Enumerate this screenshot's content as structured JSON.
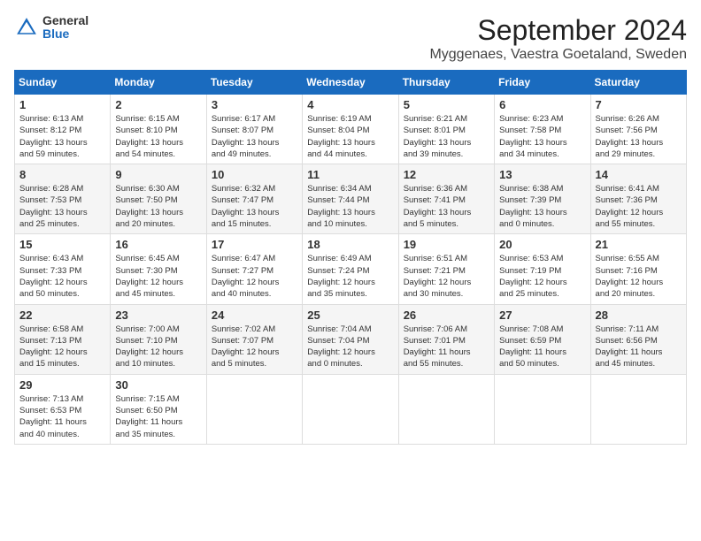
{
  "header": {
    "logo_general": "General",
    "logo_blue": "Blue",
    "month_title": "September 2024",
    "location": "Myggenaes, Vaestra Goetaland, Sweden"
  },
  "days_of_week": [
    "Sunday",
    "Monday",
    "Tuesday",
    "Wednesday",
    "Thursday",
    "Friday",
    "Saturday"
  ],
  "weeks": [
    [
      {
        "day": "1",
        "sunrise": "6:13 AM",
        "sunset": "8:12 PM",
        "daylight": "13 hours and 59 minutes"
      },
      {
        "day": "2",
        "sunrise": "6:15 AM",
        "sunset": "8:10 PM",
        "daylight": "13 hours and 54 minutes"
      },
      {
        "day": "3",
        "sunrise": "6:17 AM",
        "sunset": "8:07 PM",
        "daylight": "13 hours and 49 minutes"
      },
      {
        "day": "4",
        "sunrise": "6:19 AM",
        "sunset": "8:04 PM",
        "daylight": "13 hours and 44 minutes"
      },
      {
        "day": "5",
        "sunrise": "6:21 AM",
        "sunset": "8:01 PM",
        "daylight": "13 hours and 39 minutes"
      },
      {
        "day": "6",
        "sunrise": "6:23 AM",
        "sunset": "7:58 PM",
        "daylight": "13 hours and 34 minutes"
      },
      {
        "day": "7",
        "sunrise": "6:26 AM",
        "sunset": "7:56 PM",
        "daylight": "13 hours and 29 minutes"
      }
    ],
    [
      {
        "day": "8",
        "sunrise": "6:28 AM",
        "sunset": "7:53 PM",
        "daylight": "13 hours and 25 minutes"
      },
      {
        "day": "9",
        "sunrise": "6:30 AM",
        "sunset": "7:50 PM",
        "daylight": "13 hours and 20 minutes"
      },
      {
        "day": "10",
        "sunrise": "6:32 AM",
        "sunset": "7:47 PM",
        "daylight": "13 hours and 15 minutes"
      },
      {
        "day": "11",
        "sunrise": "6:34 AM",
        "sunset": "7:44 PM",
        "daylight": "13 hours and 10 minutes"
      },
      {
        "day": "12",
        "sunrise": "6:36 AM",
        "sunset": "7:41 PM",
        "daylight": "13 hours and 5 minutes"
      },
      {
        "day": "13",
        "sunrise": "6:38 AM",
        "sunset": "7:39 PM",
        "daylight": "13 hours and 0 minutes"
      },
      {
        "day": "14",
        "sunrise": "6:41 AM",
        "sunset": "7:36 PM",
        "daylight": "12 hours and 55 minutes"
      }
    ],
    [
      {
        "day": "15",
        "sunrise": "6:43 AM",
        "sunset": "7:33 PM",
        "daylight": "12 hours and 50 minutes"
      },
      {
        "day": "16",
        "sunrise": "6:45 AM",
        "sunset": "7:30 PM",
        "daylight": "12 hours and 45 minutes"
      },
      {
        "day": "17",
        "sunrise": "6:47 AM",
        "sunset": "7:27 PM",
        "daylight": "12 hours and 40 minutes"
      },
      {
        "day": "18",
        "sunrise": "6:49 AM",
        "sunset": "7:24 PM",
        "daylight": "12 hours and 35 minutes"
      },
      {
        "day": "19",
        "sunrise": "6:51 AM",
        "sunset": "7:21 PM",
        "daylight": "12 hours and 30 minutes"
      },
      {
        "day": "20",
        "sunrise": "6:53 AM",
        "sunset": "7:19 PM",
        "daylight": "12 hours and 25 minutes"
      },
      {
        "day": "21",
        "sunrise": "6:55 AM",
        "sunset": "7:16 PM",
        "daylight": "12 hours and 20 minutes"
      }
    ],
    [
      {
        "day": "22",
        "sunrise": "6:58 AM",
        "sunset": "7:13 PM",
        "daylight": "12 hours and 15 minutes"
      },
      {
        "day": "23",
        "sunrise": "7:00 AM",
        "sunset": "7:10 PM",
        "daylight": "12 hours and 10 minutes"
      },
      {
        "day": "24",
        "sunrise": "7:02 AM",
        "sunset": "7:07 PM",
        "daylight": "12 hours and 5 minutes"
      },
      {
        "day": "25",
        "sunrise": "7:04 AM",
        "sunset": "7:04 PM",
        "daylight": "12 hours and 0 minutes"
      },
      {
        "day": "26",
        "sunrise": "7:06 AM",
        "sunset": "7:01 PM",
        "daylight": "11 hours and 55 minutes"
      },
      {
        "day": "27",
        "sunrise": "7:08 AM",
        "sunset": "6:59 PM",
        "daylight": "11 hours and 50 minutes"
      },
      {
        "day": "28",
        "sunrise": "7:11 AM",
        "sunset": "6:56 PM",
        "daylight": "11 hours and 45 minutes"
      }
    ],
    [
      {
        "day": "29",
        "sunrise": "7:13 AM",
        "sunset": "6:53 PM",
        "daylight": "11 hours and 40 minutes"
      },
      {
        "day": "30",
        "sunrise": "7:15 AM",
        "sunset": "6:50 PM",
        "daylight": "11 hours and 35 minutes"
      },
      null,
      null,
      null,
      null,
      null
    ]
  ]
}
